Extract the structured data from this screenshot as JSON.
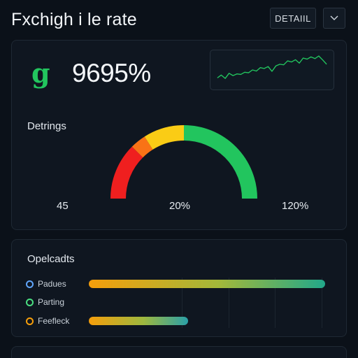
{
  "header": {
    "title": "Fxchigh i le rate",
    "detail_button": "DETAIIL",
    "caret_icon": "chevron-down-icon"
  },
  "summary": {
    "logo_glyph": "g",
    "logo_icon": "currency-g-icon",
    "big_value": "9695%",
    "sparkline": [
      0.22,
      0.32,
      0.2,
      0.38,
      0.3,
      0.36,
      0.34,
      0.42,
      0.4,
      0.5,
      0.46,
      0.58,
      0.55,
      0.62,
      0.45,
      0.64,
      0.7,
      0.68,
      0.82,
      0.78,
      0.86,
      0.74,
      0.92,
      0.88,
      0.96,
      0.9,
      0.99,
      0.85,
      0.7
    ],
    "sparkline_color": "#22c55e"
  },
  "gauge": {
    "label": "Detrings",
    "min_label": "45",
    "mid_label": "20%",
    "max_label": "120%",
    "segments": [
      {
        "from": 0.0,
        "to": 0.25,
        "color": "#ef1f1f"
      },
      {
        "from": 0.25,
        "to": 0.32,
        "color": "#f97316"
      },
      {
        "from": 0.32,
        "to": 0.5,
        "color": "#facc15"
      },
      {
        "from": 0.5,
        "to": 1.0,
        "color": "#22c55e"
      }
    ]
  },
  "operations": {
    "label": "Opelcadts",
    "items": [
      {
        "label": "Padues",
        "dot_color": "#60a5fa",
        "fill": 1.0
      },
      {
        "label": "Parting",
        "dot_color": "#4ade80",
        "fill": null
      },
      {
        "label": "Feefleck",
        "dot_color": "#f59e0b",
        "fill": 0.42
      }
    ]
  }
}
